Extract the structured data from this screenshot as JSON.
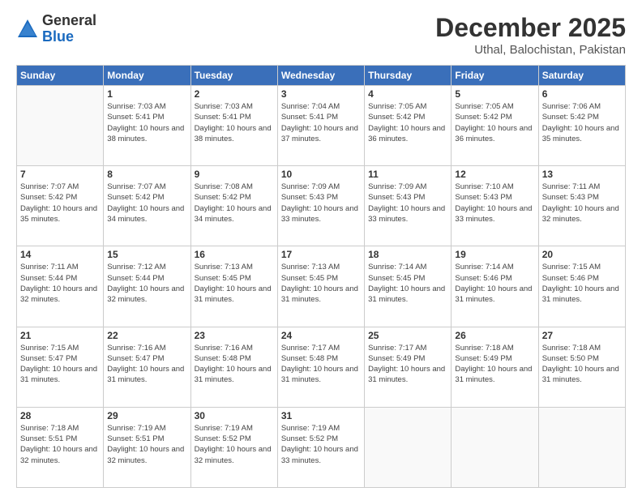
{
  "header": {
    "logo_general": "General",
    "logo_blue": "Blue",
    "month": "December 2025",
    "location": "Uthal, Balochistan, Pakistan"
  },
  "weekdays": [
    "Sunday",
    "Monday",
    "Tuesday",
    "Wednesday",
    "Thursday",
    "Friday",
    "Saturday"
  ],
  "weeks": [
    [
      {
        "day": "",
        "empty": true
      },
      {
        "day": "1",
        "sunrise": "7:03 AM",
        "sunset": "5:41 PM",
        "daylight": "10 hours and 38 minutes."
      },
      {
        "day": "2",
        "sunrise": "7:03 AM",
        "sunset": "5:41 PM",
        "daylight": "10 hours and 38 minutes."
      },
      {
        "day": "3",
        "sunrise": "7:04 AM",
        "sunset": "5:41 PM",
        "daylight": "10 hours and 37 minutes."
      },
      {
        "day": "4",
        "sunrise": "7:05 AM",
        "sunset": "5:42 PM",
        "daylight": "10 hours and 36 minutes."
      },
      {
        "day": "5",
        "sunrise": "7:05 AM",
        "sunset": "5:42 PM",
        "daylight": "10 hours and 36 minutes."
      },
      {
        "day": "6",
        "sunrise": "7:06 AM",
        "sunset": "5:42 PM",
        "daylight": "10 hours and 35 minutes."
      }
    ],
    [
      {
        "day": "7",
        "sunrise": "7:07 AM",
        "sunset": "5:42 PM",
        "daylight": "10 hours and 35 minutes."
      },
      {
        "day": "8",
        "sunrise": "7:07 AM",
        "sunset": "5:42 PM",
        "daylight": "10 hours and 34 minutes."
      },
      {
        "day": "9",
        "sunrise": "7:08 AM",
        "sunset": "5:42 PM",
        "daylight": "10 hours and 34 minutes."
      },
      {
        "day": "10",
        "sunrise": "7:09 AM",
        "sunset": "5:43 PM",
        "daylight": "10 hours and 33 minutes."
      },
      {
        "day": "11",
        "sunrise": "7:09 AM",
        "sunset": "5:43 PM",
        "daylight": "10 hours and 33 minutes."
      },
      {
        "day": "12",
        "sunrise": "7:10 AM",
        "sunset": "5:43 PM",
        "daylight": "10 hours and 33 minutes."
      },
      {
        "day": "13",
        "sunrise": "7:11 AM",
        "sunset": "5:43 PM",
        "daylight": "10 hours and 32 minutes."
      }
    ],
    [
      {
        "day": "14",
        "sunrise": "7:11 AM",
        "sunset": "5:44 PM",
        "daylight": "10 hours and 32 minutes."
      },
      {
        "day": "15",
        "sunrise": "7:12 AM",
        "sunset": "5:44 PM",
        "daylight": "10 hours and 32 minutes."
      },
      {
        "day": "16",
        "sunrise": "7:13 AM",
        "sunset": "5:45 PM",
        "daylight": "10 hours and 31 minutes."
      },
      {
        "day": "17",
        "sunrise": "7:13 AM",
        "sunset": "5:45 PM",
        "daylight": "10 hours and 31 minutes."
      },
      {
        "day": "18",
        "sunrise": "7:14 AM",
        "sunset": "5:45 PM",
        "daylight": "10 hours and 31 minutes."
      },
      {
        "day": "19",
        "sunrise": "7:14 AM",
        "sunset": "5:46 PM",
        "daylight": "10 hours and 31 minutes."
      },
      {
        "day": "20",
        "sunrise": "7:15 AM",
        "sunset": "5:46 PM",
        "daylight": "10 hours and 31 minutes."
      }
    ],
    [
      {
        "day": "21",
        "sunrise": "7:15 AM",
        "sunset": "5:47 PM",
        "daylight": "10 hours and 31 minutes."
      },
      {
        "day": "22",
        "sunrise": "7:16 AM",
        "sunset": "5:47 PM",
        "daylight": "10 hours and 31 minutes."
      },
      {
        "day": "23",
        "sunrise": "7:16 AM",
        "sunset": "5:48 PM",
        "daylight": "10 hours and 31 minutes."
      },
      {
        "day": "24",
        "sunrise": "7:17 AM",
        "sunset": "5:48 PM",
        "daylight": "10 hours and 31 minutes."
      },
      {
        "day": "25",
        "sunrise": "7:17 AM",
        "sunset": "5:49 PM",
        "daylight": "10 hours and 31 minutes."
      },
      {
        "day": "26",
        "sunrise": "7:18 AM",
        "sunset": "5:49 PM",
        "daylight": "10 hours and 31 minutes."
      },
      {
        "day": "27",
        "sunrise": "7:18 AM",
        "sunset": "5:50 PM",
        "daylight": "10 hours and 31 minutes."
      }
    ],
    [
      {
        "day": "28",
        "sunrise": "7:18 AM",
        "sunset": "5:51 PM",
        "daylight": "10 hours and 32 minutes."
      },
      {
        "day": "29",
        "sunrise": "7:19 AM",
        "sunset": "5:51 PM",
        "daylight": "10 hours and 32 minutes."
      },
      {
        "day": "30",
        "sunrise": "7:19 AM",
        "sunset": "5:52 PM",
        "daylight": "10 hours and 32 minutes."
      },
      {
        "day": "31",
        "sunrise": "7:19 AM",
        "sunset": "5:52 PM",
        "daylight": "10 hours and 33 minutes."
      },
      {
        "day": "",
        "empty": true
      },
      {
        "day": "",
        "empty": true
      },
      {
        "day": "",
        "empty": true
      }
    ]
  ]
}
